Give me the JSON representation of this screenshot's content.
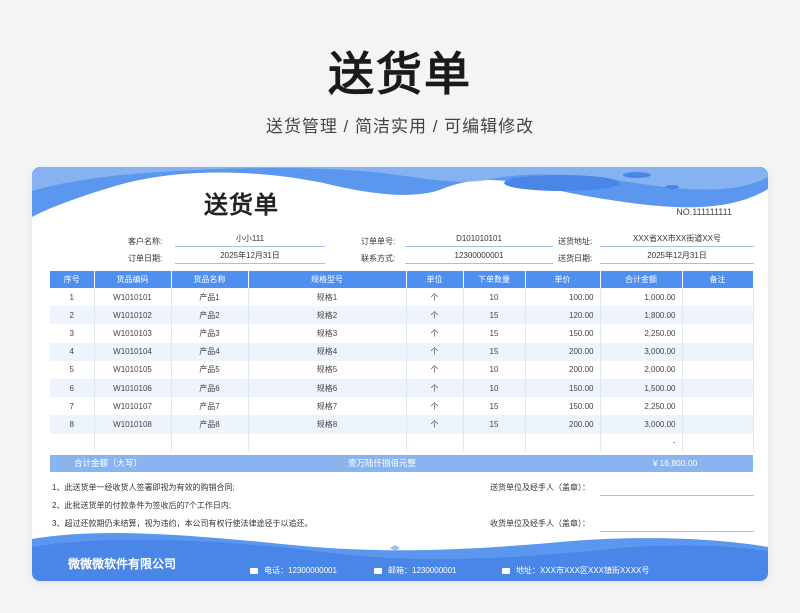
{
  "hero": {
    "title": "送货单",
    "subtitle": "送货管理 / 简洁实用 /  可编辑修改"
  },
  "doc": {
    "title": "送货单",
    "number": "NO.111111111",
    "info": {
      "customer_label": "客户名称:",
      "customer": "小小111",
      "order_no_label": "订单单号:",
      "order_no": "D101010101",
      "address_label": "送货地址:",
      "address": "XXX省XX市XX街道XX号",
      "order_date_label": "订单日期:",
      "order_date": "2025年12月31日",
      "contact_label": "联系方式:",
      "contact": "12300000001",
      "delivery_date_label": "送货日期:",
      "delivery_date": "2025年12月31日"
    },
    "columns": [
      "序号",
      "货品编码",
      "货品名称",
      "规格型号",
      "单位",
      "下单数量",
      "单价",
      "合计金额",
      "备注"
    ],
    "rows": [
      [
        "1",
        "W1010101",
        "产品1",
        "规格1",
        "个",
        "10",
        "100.00",
        "1,000.00",
        ""
      ],
      [
        "2",
        "W1010102",
        "产品2",
        "规格2",
        "个",
        "15",
        "120.00",
        "1,800.00",
        ""
      ],
      [
        "3",
        "W1010103",
        "产品3",
        "规格3",
        "个",
        "15",
        "150.00",
        "2,250.00",
        ""
      ],
      [
        "4",
        "W1010104",
        "产品4",
        "规格4",
        "个",
        "15",
        "200.00",
        "3,000.00",
        ""
      ],
      [
        "5",
        "W1010105",
        "产品5",
        "规格5",
        "个",
        "10",
        "200.00",
        "2,000.00",
        ""
      ],
      [
        "6",
        "W1010106",
        "产品6",
        "规格6",
        "个",
        "10",
        "150.00",
        "1,500.00",
        ""
      ],
      [
        "7",
        "W1010107",
        "产品7",
        "规格7",
        "个",
        "15",
        "150.00",
        "2,250.00",
        ""
      ],
      [
        "8",
        "W1010108",
        "产品8",
        "规格8",
        "个",
        "15",
        "200.00",
        "3,000.00",
        ""
      ],
      [
        "",
        "",
        "",
        "",
        "",
        "",
        "",
        "-",
        ""
      ]
    ],
    "total": {
      "label": "合计金额（大写）",
      "upper": "壹万陆仟捌佰元整",
      "amount": "￥16,800.00"
    },
    "notes": [
      "1、此送货单一经收货人签署即视为有效的购销合同;",
      "2、此批送货单的付款条件为签收后的7个工作日内;",
      "3、超过还款期仍未结算，视为违约，本公司有权行使法律途径于以追还。"
    ],
    "sign_sender": "送货单位及经手人（盖章）：",
    "sign_receiver": "收货单位及经手人（盖章）：",
    "company": "微微微软件有限公司",
    "footer": {
      "phone": "电话：12300000001",
      "email": "邮箱：1230000001",
      "address": "地址：XXX市XXX区XXX镇街XXXX号"
    }
  }
}
